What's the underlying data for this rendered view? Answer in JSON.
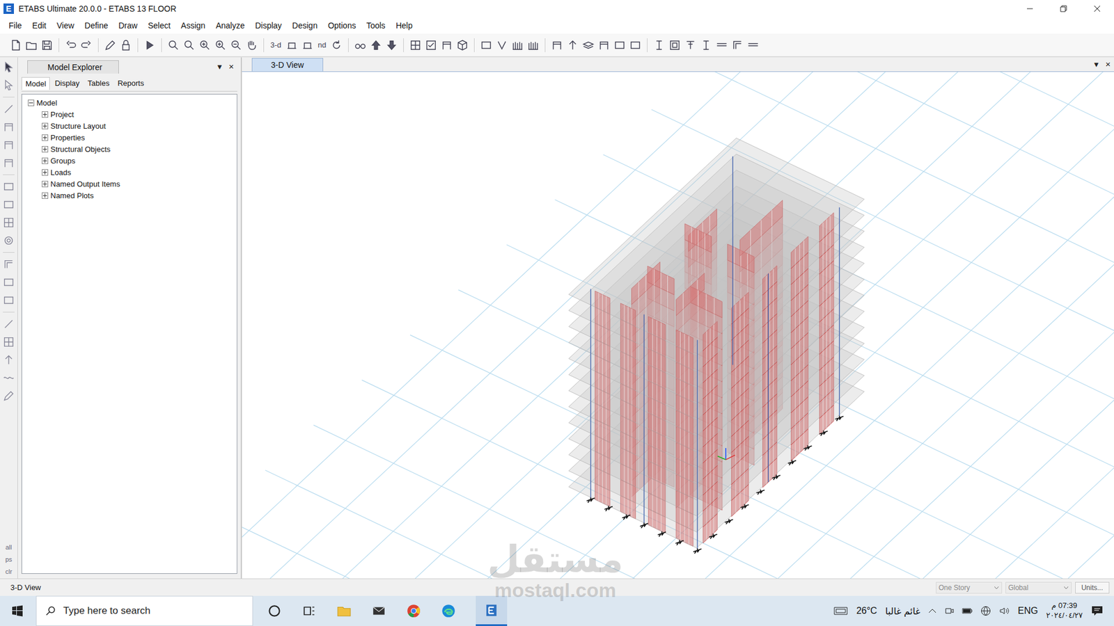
{
  "window": {
    "title": "ETABS Ultimate 20.0.0 - ETABS 13 FLOOR",
    "app_icon": "E"
  },
  "menu": [
    "File",
    "Edit",
    "View",
    "Define",
    "Draw",
    "Select",
    "Assign",
    "Analyze",
    "Display",
    "Design",
    "Options",
    "Tools",
    "Help"
  ],
  "toolbar": {
    "labels": [
      "3-d",
      "nd"
    ]
  },
  "left_toolbar": {
    "labels": [
      "all",
      "ps",
      "clr"
    ]
  },
  "panel_controls": [
    "▾",
    "×"
  ],
  "model_explorer": {
    "title": "Model Explorer",
    "tabs": [
      {
        "label": "Model",
        "selected": true
      },
      {
        "label": "Display",
        "selected": false
      },
      {
        "label": "Tables",
        "selected": false
      },
      {
        "label": "Reports",
        "selected": false
      }
    ],
    "tree": {
      "label": "Model",
      "expanded": true,
      "children": [
        {
          "label": "Project",
          "expanded": false
        },
        {
          "label": "Structure Layout",
          "expanded": false
        },
        {
          "label": "Properties",
          "expanded": false
        },
        {
          "label": "Structural Objects",
          "expanded": false
        },
        {
          "label": "Groups",
          "expanded": false
        },
        {
          "label": "Loads",
          "expanded": false
        },
        {
          "label": "Named Output Items",
          "expanded": false
        },
        {
          "label": "Named Plots",
          "expanded": false
        }
      ]
    }
  },
  "view": {
    "tabs": [
      {
        "label": "3-D View",
        "selected": true
      }
    ],
    "model": {
      "stories": 13
    }
  },
  "status_bar": {
    "left": "3-D View",
    "story": "One Story",
    "coord": "Global",
    "units": "Units..."
  },
  "taskbar": {
    "search_placeholder": "Type here to search",
    "temperature": "26°C",
    "weather": "غائم غالبا",
    "language": "ENG",
    "time": "07:39 م",
    "date": "٢٠٢٤/٠٤/٢٧"
  },
  "watermark": {
    "arabic": "مستقل",
    "latin": "mostaql.com"
  }
}
